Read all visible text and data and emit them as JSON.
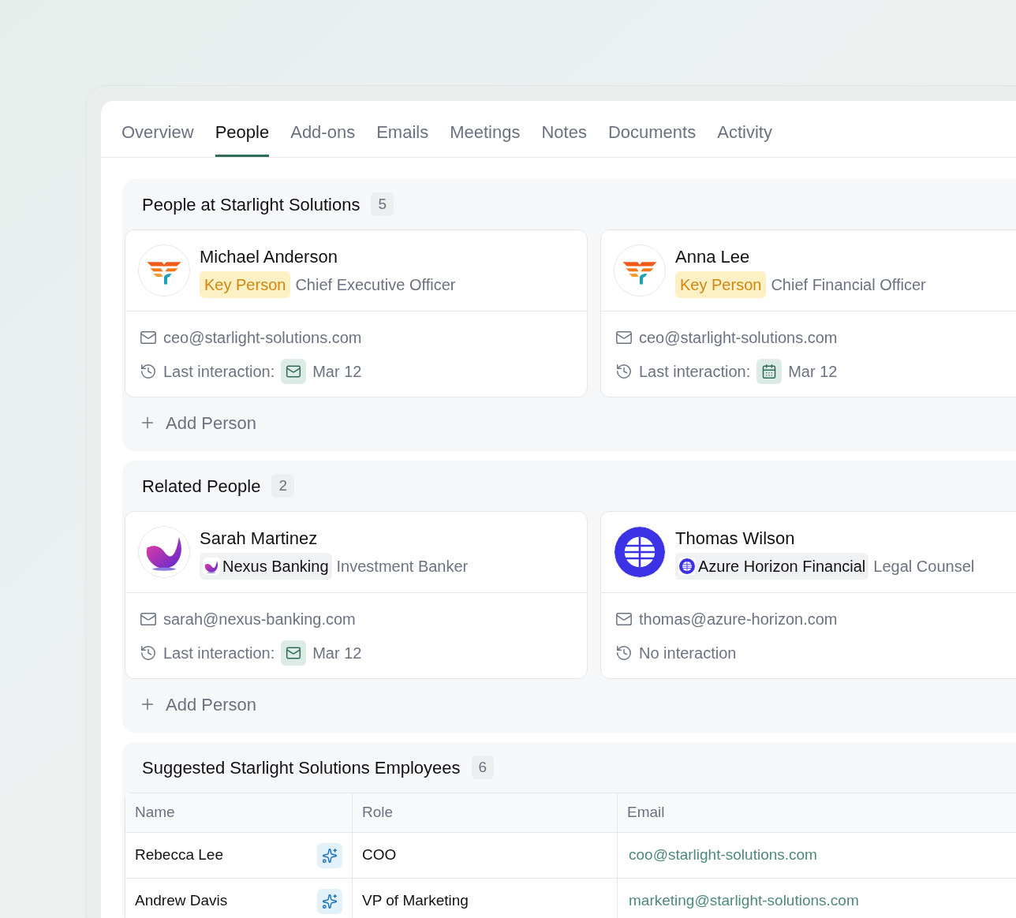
{
  "tabs": [
    {
      "label": "Overview",
      "selected": false
    },
    {
      "label": "People",
      "selected": true
    },
    {
      "label": "Add-ons",
      "selected": false
    },
    {
      "label": "Emails",
      "selected": false
    },
    {
      "label": "Meetings",
      "selected": false
    },
    {
      "label": "Notes",
      "selected": false
    },
    {
      "label": "Documents",
      "selected": false
    },
    {
      "label": "Activity",
      "selected": false
    }
  ],
  "sections": [
    {
      "title": "People at Starlight Solutions",
      "count": "5",
      "add_label": "Add Person",
      "people": [
        {
          "name": "Michael Anderson",
          "logo": {
            "kind": "phoenix"
          },
          "badge": {
            "kind": "key",
            "label": "Key Person"
          },
          "role": "Chief Executive Officer",
          "email": "ceo@starlight-solutions.com",
          "interaction": {
            "kind": "email",
            "label": "Last interaction:",
            "date": "Mar 12"
          }
        },
        {
          "name": "Anna Lee",
          "logo": {
            "kind": "phoenix"
          },
          "badge": {
            "kind": "key",
            "label": "Key Person"
          },
          "role": "Chief Financial Officer",
          "email": "ceo@starlight-solutions.com",
          "interaction": {
            "kind": "calendar",
            "label": "Last interaction:",
            "date": "Mar 12"
          }
        }
      ]
    },
    {
      "title": "Related People",
      "count": "2",
      "add_label": "Add Person",
      "people": [
        {
          "name": "Sarah Martinez",
          "logo": {
            "kind": "swirl"
          },
          "badge": {
            "kind": "company",
            "label": "Nexus Banking"
          },
          "role": "Investment Banker",
          "email": "sarah@nexus-banking.com",
          "interaction": {
            "kind": "email",
            "label": "Last interaction:",
            "date": "Mar 12"
          }
        },
        {
          "name": "Thomas Wilson",
          "logo": {
            "kind": "globe"
          },
          "badge": {
            "kind": "company",
            "label": "Azure Horizon Financial"
          },
          "role": "Legal Counsel",
          "email": "thomas@azure-horizon.com",
          "interaction": {
            "kind": "none",
            "label": "No interaction"
          }
        }
      ]
    }
  ],
  "suggested": {
    "title": "Suggested Starlight Solutions Employees",
    "count": "6",
    "columns": [
      "Name",
      "Role",
      "Email"
    ],
    "rows": [
      {
        "name": "Rebecca Lee",
        "role": "COO",
        "email": "coo@starlight-solutions.com"
      },
      {
        "name": "Andrew Davis",
        "role": "VP of Marketing",
        "email": "marketing@starlight-solutions.com"
      }
    ]
  }
}
